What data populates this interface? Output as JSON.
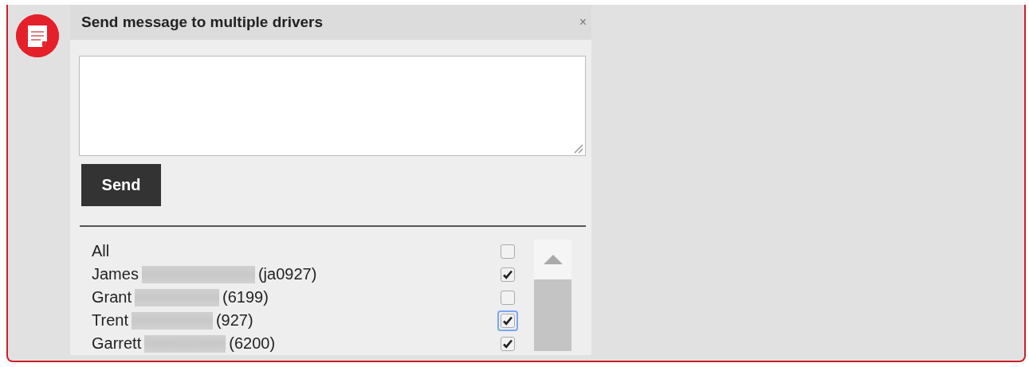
{
  "dialog": {
    "title": "Send message to multiple drivers",
    "close": "×",
    "send_button": "Send"
  },
  "drivers": [
    {
      "name": "All",
      "checked": false,
      "focused": false
    },
    {
      "name": "James",
      "code": "(ja0927)",
      "checked": true,
      "focused": false
    },
    {
      "name": "Grant",
      "code": "(6199)",
      "checked": false,
      "focused": false
    },
    {
      "name": "Trent",
      "code": "(927)",
      "checked": true,
      "focused": true
    },
    {
      "name": "Garrett",
      "code": "(6200)",
      "checked": true,
      "focused": false
    }
  ]
}
